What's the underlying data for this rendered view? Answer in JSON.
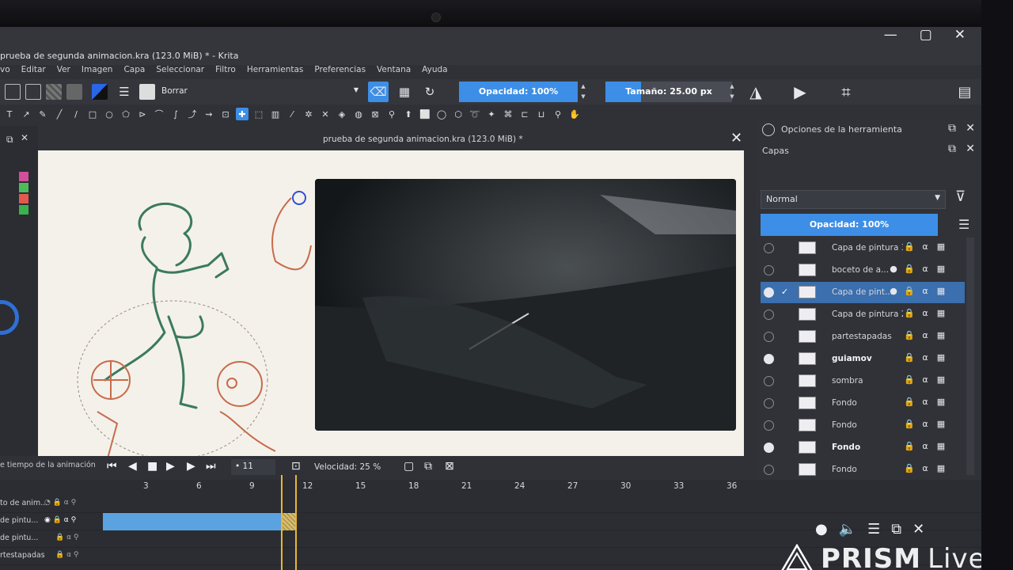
{
  "window": {
    "title": "prueba de segunda animacion.kra (123.0 MiB) * - Krita",
    "controls": [
      "—",
      "▢",
      "✕"
    ]
  },
  "menubar": [
    "vo",
    "Editar",
    "Ver",
    "Imagen",
    "Capa",
    "Seleccionar",
    "Filtro",
    "Herramientas",
    "Preferencias",
    "Ventana",
    "Ayuda"
  ],
  "toolbar": {
    "brush_preset": "Borrar",
    "opacity": "Opacidad: 100%",
    "size": "Tamaño: 25.00 px",
    "size_fraction": 0.28
  },
  "document": {
    "tab_title": "prueba de segunda animacion.kra (123.0 MiB) *",
    "close": "✕"
  },
  "docker": {
    "tool_options_title": "Opciones de la herramienta",
    "layers_title": "Capas",
    "blend_mode": "Normal",
    "layer_opacity": "Opacidad:  100%",
    "layers": [
      {
        "name": "Capa de pintura 3",
        "visible": false,
        "selected": false,
        "bold": false
      },
      {
        "name": "boceto de a...",
        "visible": false,
        "selected": false,
        "bold": false
      },
      {
        "name": "Capa de pint...",
        "visible": true,
        "selected": true,
        "bold": false
      },
      {
        "name": "Capa de pintura 2",
        "visible": false,
        "selected": false,
        "bold": false
      },
      {
        "name": "partestapadas",
        "visible": false,
        "selected": false,
        "bold": false
      },
      {
        "name": "guiamov",
        "visible": true,
        "selected": false,
        "bold": true
      },
      {
        "name": "sombra",
        "visible": false,
        "selected": false,
        "bold": false
      },
      {
        "name": "Fondo",
        "visible": false,
        "selected": false,
        "bold": false
      },
      {
        "name": "Fondo",
        "visible": false,
        "selected": false,
        "bold": false
      },
      {
        "name": "Fondo",
        "visible": true,
        "selected": false,
        "bold": true
      },
      {
        "name": "Fondo",
        "visible": false,
        "selected": false,
        "bold": false
      }
    ]
  },
  "animation": {
    "panel_label": "e tiempo de la animación",
    "current_frame": "11",
    "speed": "Velocidad: 25 %",
    "ruler_ticks": [
      "3",
      "6",
      "9",
      "12",
      "15",
      "18",
      "21",
      "24",
      "27",
      "30",
      "33",
      "36"
    ],
    "rows": [
      "to de anim...",
      "de pintu...",
      "de pintu...",
      "rtestapadas"
    ]
  },
  "watermark": {
    "brand": "PRISM",
    "suffix": "Live"
  },
  "colors": {
    "accent": "#3d8ee6",
    "panel": "#303238",
    "selected_layer": "#3b6fae",
    "frame_marker": "#e8b730"
  },
  "icons": {
    "eraser": "eraser-icon",
    "checker": "alpha-lock-icon",
    "refresh": "reload-preset-icon",
    "mirror_h": "mirror-horizontal-icon",
    "mirror_v": "mirror-vertical-icon",
    "crop": "wrap-around-icon",
    "workspace": "workspace-icon"
  }
}
